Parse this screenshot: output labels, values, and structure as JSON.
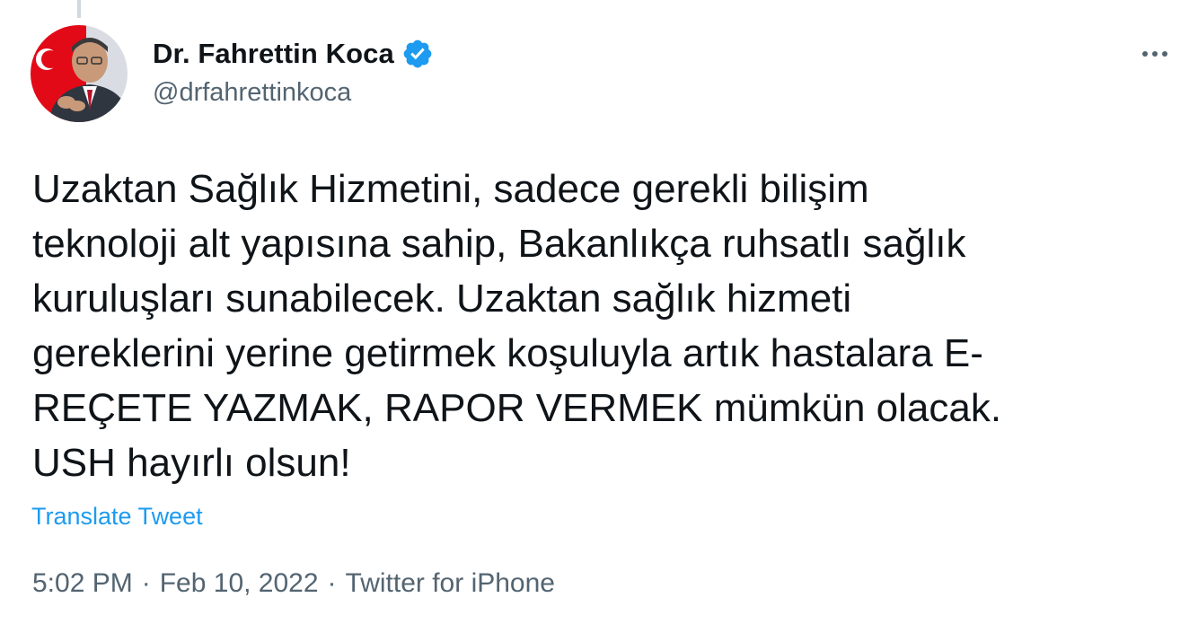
{
  "colors": {
    "text": "#0f1419",
    "secondary": "#536471",
    "link": "#1d9bf0",
    "verified_badge": "#1d9bf0",
    "avatar_flag_red": "#e30a17"
  },
  "author": {
    "display_name": "Dr. Fahrettin Koca",
    "handle": "@drfahrettinkoca",
    "verified": true,
    "avatar_icon": "profile-photo"
  },
  "tweet": {
    "text": "Uzaktan Sağlık Hizmetini, sadece gerekli bilişim\nteknoloji alt yapısına sahip, Bakanlıkça ruhsatlı sağlık\nkuruluşları sunabilecek. Uzaktan sağlık hizmeti\ngereklerini yerine getirmek koşuluyla artık hastalara E-\nREÇETE YAZMAK, RAPOR VERMEK mümkün olacak.\nUSH hayırlı olsun!",
    "translate_label": "Translate Tweet",
    "time": "5:02 PM",
    "date": "Feb 10, 2022",
    "source": "Twitter for iPhone",
    "separator": "·"
  },
  "menu": {
    "more_icon": "more-horizontal-icon"
  }
}
